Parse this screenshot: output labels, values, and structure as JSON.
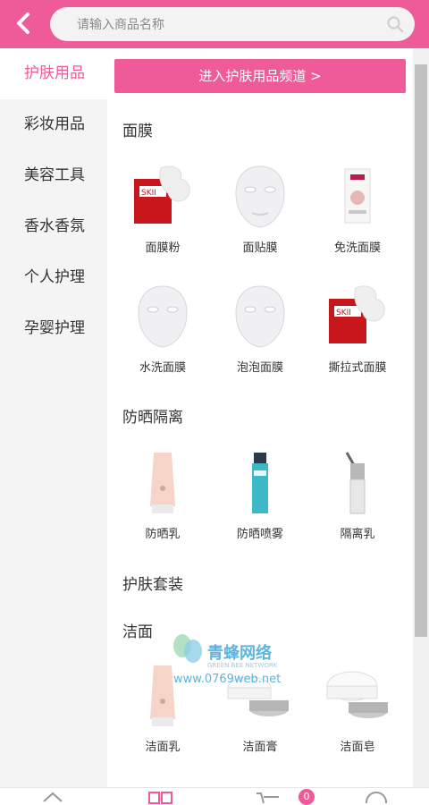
{
  "header": {
    "search_placeholder": "请输入商品名称"
  },
  "sidebar": {
    "items": [
      {
        "label": "护肤用品"
      },
      {
        "label": "彩妆用品"
      },
      {
        "label": "美容工具"
      },
      {
        "label": "香水香氛"
      },
      {
        "label": "个人护理"
      },
      {
        "label": "孕婴护理"
      }
    ]
  },
  "main": {
    "channel_button": "进入护肤用品频道 >",
    "sections": [
      {
        "title": "面膜",
        "items": [
          "面膜粉",
          "面贴膜",
          "免洗面膜",
          "水洗面膜",
          "泡泡面膜",
          "撕拉式面膜"
        ]
      },
      {
        "title": "防晒隔离",
        "items": [
          "防晒乳",
          "防晒喷雾",
          "隔离乳"
        ]
      },
      {
        "title": "护肤套装",
        "items": []
      },
      {
        "title": "洁面",
        "items": [
          "洁面乳",
          "洁面膏",
          "洁面皂"
        ]
      }
    ]
  },
  "watermark": {
    "name": "青蜂网络",
    "en": "GREEN BEE NETWORK",
    "url": "www.0769web.net"
  },
  "cart_badge": "0",
  "colors": {
    "accent": "#ef5a98"
  }
}
